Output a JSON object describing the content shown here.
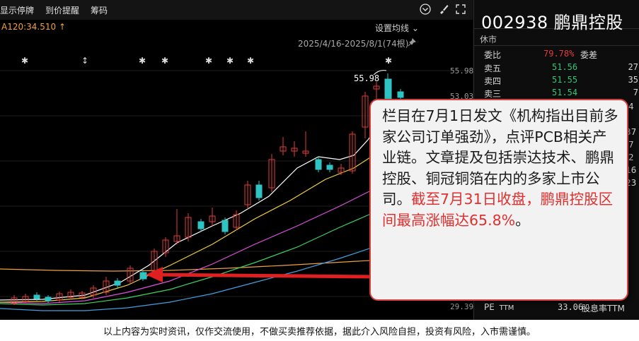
{
  "toolbar": {
    "show_suspended": "显示停牌",
    "price_alert": "到价提醒",
    "chips": "筹码"
  },
  "chart": {
    "ma_label": "A120:34.510 ↑",
    "avg_settings": "设置均线 ⌄",
    "date_range": "2025/4/16-2025/8/1(74根)",
    "peak_label": "55.98",
    "price_ticks": [
      "55.98",
      "53.03",
      "29.39"
    ]
  },
  "stock": {
    "title": "002938 鹏鼎控股",
    "status": "休市"
  },
  "order_book": {
    "weibi_label": "委比",
    "weibi_value": "79.78%",
    "weicha_label": "委差",
    "rows": [
      {
        "label": "卖五",
        "price": "51.56",
        "vol": "27"
      },
      {
        "label": "卖四",
        "price": "51.55",
        "vol": "35"
      },
      {
        "label": "卖三",
        "price": "51.54",
        "vol": "7"
      }
    ],
    "partial_vols": [
      "4",
      "37",
      "7",
      "2",
      "16",
      "23"
    ]
  },
  "annotation": {
    "text_main": "栏目在7月1日发文《机构指出目前多家公司订单强劲》，点评PCB相关产业链。文章提及包括崇达技术、鹏鼎控股、铜冠铜箔在内的多家上市公司。",
    "text_highlight_1": "截至7月31日收盘，鹏鼎控股区间最高涨幅达65.8%",
    "text_tail": "。"
  },
  "pe": {
    "label": "PE",
    "sub": "TTM",
    "value": "33.06",
    "right_label": "股息率TTM"
  },
  "disclaimer": "以上内容为实时资讯，仅作交流使用，不做买卖推荐依据，据此介入风险自担，投资有风险，入市需谨慎。",
  "colors": {
    "up": "#e23c3c",
    "down": "#2ec4c4",
    "ma5": "#ffffff",
    "ma10": "#f0d040",
    "ma20": "#e050e0",
    "ma30": "#40d060",
    "ma60": "#40a0e0",
    "ma120": "#f0a040",
    "annotation_border": "#d84040"
  }
}
